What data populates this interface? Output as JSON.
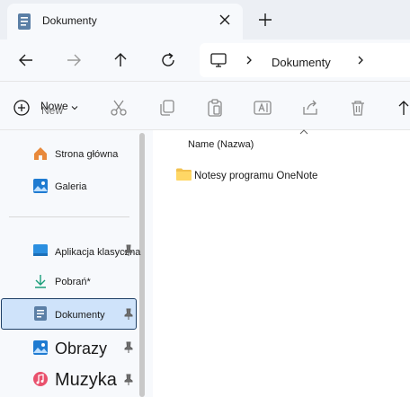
{
  "window": {
    "tab_title": "Dokumenty"
  },
  "addressbar": {
    "breadcrumb_current": "Dokumenty"
  },
  "toolbar": {
    "new_label": "Nowe",
    "new_ghost_label": "New"
  },
  "sidebar": {
    "items": [
      {
        "label": "Strona główna",
        "icon": "home-icon"
      },
      {
        "label": "Galeria",
        "icon": "gallery-icon"
      },
      {
        "label": "Aplikacja klasyczna",
        "icon": "desktop-icon",
        "pinned": true
      },
      {
        "label": "Pobrań*",
        "icon": "download-icon"
      },
      {
        "label": "Dokumenty",
        "icon": "documents-icon",
        "pinned": true,
        "selected": true
      },
      {
        "label": "Obrazy",
        "icon": "pictures-icon",
        "pinned": true
      },
      {
        "label": "Muzyka",
        "icon": "music-icon",
        "pinned": true
      }
    ]
  },
  "content": {
    "column_name": "Name (Nazwa)",
    "files": [
      {
        "name": "Notesy programu OneNote",
        "type": "folder"
      }
    ]
  },
  "colors": {
    "accent": "#0067c0",
    "selection_bg": "#cfe3fa",
    "selection_border": "#1e3f66",
    "folder": "#f2c14e"
  }
}
